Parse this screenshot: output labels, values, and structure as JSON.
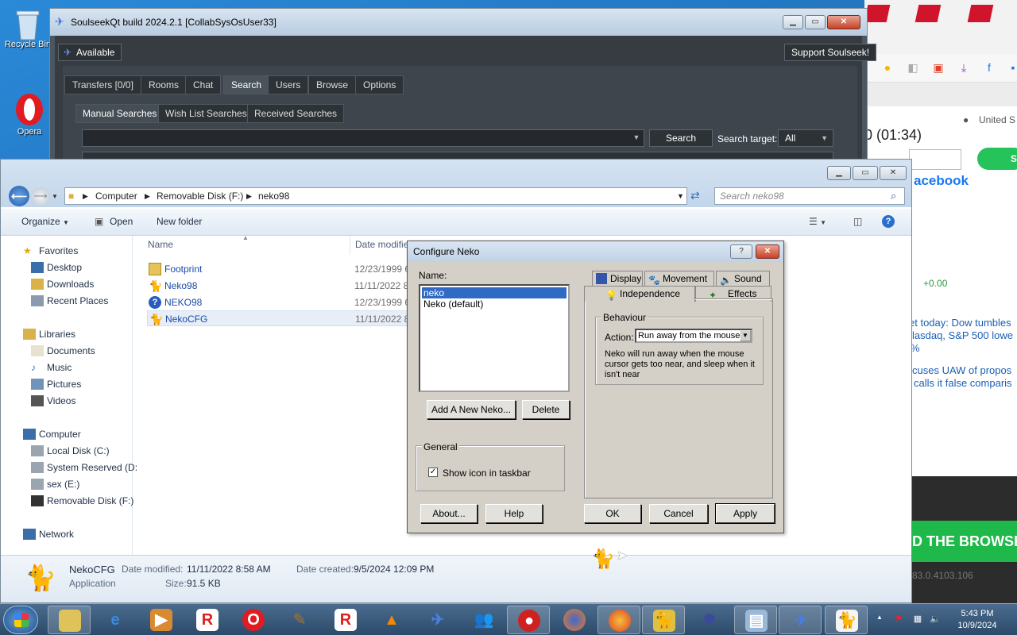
{
  "desktop": {
    "icons": [
      {
        "label": "Recycle Bin",
        "icon": "recycle-bin-icon"
      },
      {
        "label": "Opera",
        "icon": "opera-icon"
      }
    ]
  },
  "browser_bg": {
    "region_text": "United S",
    "timer_text": "0 (01:34)",
    "facebook_text": "acebook",
    "green_btn_text": "S",
    "change_text": "+0.00",
    "news1_line1": "et today: Dow tumbles",
    "news1_line2": "lasdaq, S&P 500 lowe",
    "news1_line3": "%",
    "news2_line1": "cuses UAW of propos",
    "news2_line2": "calls it false comparis",
    "banner_text": "D THE BROWSER",
    "version_text": "83.0.4103.106"
  },
  "soulseek": {
    "title": "SoulseekQt build 2024.2.1 [CollabSysOsUser33]",
    "status_button": "Available",
    "support_button": "Support Soulseek!",
    "tabs": [
      "Transfers [0/0]",
      "Rooms",
      "Chat",
      "Search",
      "Users",
      "Browse",
      "Options"
    ],
    "active_tab": "Search",
    "subtabs": [
      "Manual Searches",
      "Wish List Searches",
      "Received Searches"
    ],
    "search_button": "Search",
    "search_target_label": "Search target:",
    "search_target_value": "All"
  },
  "explorer": {
    "breadcrumb": [
      "Computer",
      "Removable Disk (F:)",
      "neko98"
    ],
    "search_placeholder": "Search neko98",
    "toolbar": {
      "organize": "Organize",
      "open": "Open",
      "new_folder": "New folder"
    },
    "nav": {
      "favorites": "Favorites",
      "favorites_items": [
        "Desktop",
        "Downloads",
        "Recent Places"
      ],
      "libraries": "Libraries",
      "libraries_items": [
        "Documents",
        "Music",
        "Pictures",
        "Videos"
      ],
      "computer": "Computer",
      "computer_items": [
        "Local Disk (C:)",
        "System Reserved (D:",
        "sex (E:)",
        "Removable Disk (F:)"
      ],
      "network": "Network"
    },
    "columns": {
      "name": "Name",
      "date_modified": "Date modifie"
    },
    "files": [
      {
        "name": "Footprint",
        "date": "12/23/1999 6",
        "icon": "folder-icon"
      },
      {
        "name": "Neko98",
        "date": "11/11/2022 8",
        "icon": "neko-exe-icon"
      },
      {
        "name": "NEKO98",
        "date": "12/23/1999 6",
        "icon": "help-file-icon"
      },
      {
        "name": "NekoCFG",
        "date": "11/11/2022 8",
        "icon": "neko-cfg-icon"
      }
    ],
    "selected_file": "NekoCFG",
    "details": {
      "name": "NekoCFG",
      "type": "Application",
      "date_modified_label": "Date modified:",
      "date_modified": "11/11/2022 8:58 AM",
      "date_created_label": "Date created:",
      "date_created": "9/5/2024 12:09 PM",
      "size_label": "Size:",
      "size": "91.5 KB"
    }
  },
  "neko_dialog": {
    "title": "Configure Neko",
    "name_label": "Name:",
    "names": [
      "neko",
      "Neko (default)"
    ],
    "selected_name": "neko",
    "add_button": "Add A New Neko...",
    "delete_button": "Delete",
    "general_label": "General",
    "show_icon_label": "Show icon in taskbar",
    "show_icon_checked": true,
    "tabs_row1": [
      "Display",
      "Movement",
      "Sound"
    ],
    "tabs_row2": [
      "Independence",
      "Effects"
    ],
    "active_tab": "Independence",
    "behaviour_label": "Behaviour",
    "action_label": "Action:",
    "action_value": "Run away from the mouse",
    "description": "Neko will run away when the mouse cursor gets too near, and sleep when it isn't near",
    "about_button": "About...",
    "help_button": "Help",
    "ok_button": "OK",
    "cancel_button": "Cancel",
    "apply_button": "Apply"
  },
  "taskbar": {
    "time": "5:43 PM",
    "date": "10/9/2024",
    "items": [
      "start",
      "explorer",
      "ie",
      "media",
      "roblox",
      "opera",
      "gimp",
      "roblox2",
      "vlc",
      "soulseek",
      "msn",
      "angry-bird",
      "firefox",
      "firefox-dev",
      "cat-folder",
      "bug",
      "files",
      "soulseek2",
      "neko"
    ]
  },
  "colors": {
    "soulseek_bg": "#363c42",
    "win7_frame": "#c2d6ea",
    "dialog_face": "#d4d0c8",
    "selection": "#316ac5"
  }
}
